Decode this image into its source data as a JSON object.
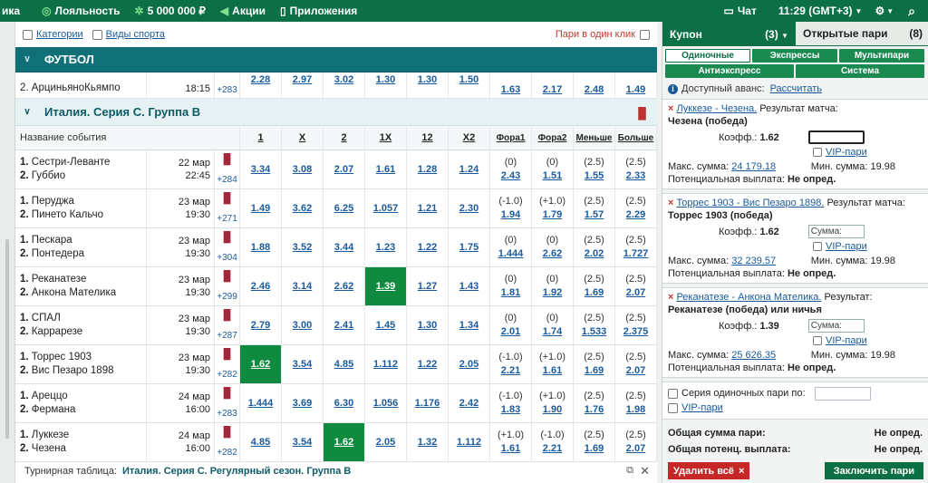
{
  "topbar": {
    "cut_label": "ика",
    "loyalty": "Лояльность",
    "bonus": "5 000 000 ₽",
    "promo": "Акции",
    "apps": "Приложения",
    "chat": "Чат",
    "time": "11:29 (GMT+3)",
    "settings_glyph": "⚙",
    "search_glyph": "⌕"
  },
  "filters": {
    "categories": "Категории",
    "sports": "Виды спорта",
    "one_click": "Пари в один клик"
  },
  "sport": {
    "title": "ФУТБОЛ"
  },
  "partial_event": {
    "team2": "2. АрциньяноКьямпо",
    "date": "24 мар",
    "time": "18:15",
    "more": "+283",
    "odds": [
      "2.28",
      "2.97",
      "3.02",
      "1.30",
      "1.30",
      "1.50"
    ],
    "ext": [
      "1.63",
      "2.17",
      "2.48",
      "1.49"
    ]
  },
  "league": {
    "title": "Италия. Серия С. Группа В"
  },
  "columns": {
    "name": "Название события",
    "c1": "1",
    "cx": "X",
    "c2": "2",
    "c1x": "1X",
    "c12": "12",
    "cx2": "X2",
    "h1": "Фора1",
    "h2": "Фора2",
    "under": "Меньше",
    "over": "Больше"
  },
  "events": [
    {
      "t1": "Сестри-Леванте",
      "t2": "Губбио",
      "date": "22 мар",
      "time": "22:45",
      "more": "+284",
      "odds": [
        "3.34",
        "3.08",
        "2.07",
        "1.61",
        "1.28",
        "1.24"
      ],
      "h1p": "(0)",
      "h1v": "2.43",
      "h2p": "(0)",
      "h2v": "1.51",
      "up": "(2.5)",
      "uv": "1.55",
      "op": "(2.5)",
      "ov": "2.33",
      "sel": -1
    },
    {
      "t1": "Перуджа",
      "t2": "Пинето Кальчо",
      "date": "23 мар",
      "time": "19:30",
      "more": "+271",
      "odds": [
        "1.49",
        "3.62",
        "6.25",
        "1.057",
        "1.21",
        "2.30"
      ],
      "h1p": "(-1.0)",
      "h1v": "1.94",
      "h2p": "(+1.0)",
      "h2v": "1.79",
      "up": "(2.5)",
      "uv": "1.57",
      "op": "(2.5)",
      "ov": "2.29",
      "sel": -1
    },
    {
      "t1": "Пескара",
      "t2": "Понтедера",
      "date": "23 мар",
      "time": "19:30",
      "more": "+304",
      "odds": [
        "1.88",
        "3.52",
        "3.44",
        "1.23",
        "1.22",
        "1.75"
      ],
      "h1p": "(0)",
      "h1v": "1.444",
      "h2p": "(0)",
      "h2v": "2.62",
      "up": "(2.5)",
      "uv": "2.02",
      "op": "(2.5)",
      "ov": "1.727",
      "sel": -1
    },
    {
      "t1": "Реканатезе",
      "t2": "Анкона Мателика",
      "date": "23 мар",
      "time": "19:30",
      "more": "+299",
      "odds": [
        "2.46",
        "3.14",
        "2.62",
        "1.39",
        "1.27",
        "1.43"
      ],
      "h1p": "(0)",
      "h1v": "1.81",
      "h2p": "(0)",
      "h2v": "1.92",
      "up": "(2.5)",
      "uv": "1.69",
      "op": "(2.5)",
      "ov": "2.07",
      "sel": 3
    },
    {
      "t1": "СПАЛ",
      "t2": "Каррарезе",
      "date": "23 мар",
      "time": "19:30",
      "more": "+287",
      "odds": [
        "2.79",
        "3.00",
        "2.41",
        "1.45",
        "1.30",
        "1.34"
      ],
      "h1p": "(0)",
      "h1v": "2.01",
      "h2p": "(0)",
      "h2v": "1.74",
      "up": "(2.5)",
      "uv": "1.533",
      "op": "(2.5)",
      "ov": "2.375",
      "sel": -1
    },
    {
      "t1": "Торрес 1903",
      "t2": "Вис Пезаро 1898",
      "date": "23 мар",
      "time": "19:30",
      "more": "+282",
      "odds": [
        "1.62",
        "3.54",
        "4.85",
        "1.112",
        "1.22",
        "2.05"
      ],
      "h1p": "(-1.0)",
      "h1v": "2.21",
      "h2p": "(+1.0)",
      "h2v": "1.61",
      "up": "(2.5)",
      "uv": "1.69",
      "op": "(2.5)",
      "ov": "2.07",
      "sel": 0
    },
    {
      "t1": "Ареццо",
      "t2": "Фермана",
      "date": "24 мар",
      "time": "16:00",
      "more": "+283",
      "odds": [
        "1.444",
        "3.69",
        "6.30",
        "1.056",
        "1.176",
        "2.42"
      ],
      "h1p": "(-1.0)",
      "h1v": "1.83",
      "h2p": "(+1.0)",
      "h2v": "1.90",
      "up": "(2.5)",
      "uv": "1.76",
      "op": "(2.5)",
      "ov": "1.98",
      "sel": -1
    },
    {
      "t1": "Луккезе",
      "t2": "Чезена",
      "date": "24 мар",
      "time": "16:00",
      "more": "+282",
      "odds": [
        "4.85",
        "3.54",
        "1.62",
        "2.05",
        "1.32",
        "1.112"
      ],
      "h1p": "(+1.0)",
      "h1v": "1.61",
      "h2p": "(-1.0)",
      "h2v": "2.21",
      "up": "(2.5)",
      "uv": "1.69",
      "op": "(2.5)",
      "ov": "2.07",
      "sel": 2
    }
  ],
  "tournament": {
    "label": "Турнирная таблица:",
    "name": "Италия. Серия С. Регулярный сезон. Группа В"
  },
  "coupon": {
    "tab_coupon": "Купон",
    "tab_coupon_count": "(3)",
    "tab_open": "Открытые пари",
    "tab_open_count": "(8)",
    "types": [
      "Одиночные",
      "Экспрессы",
      "Мультипари",
      "Антиэкспресс",
      "Система"
    ],
    "advance_label": "Доступный аванс:",
    "advance_link": "Рассчитать",
    "coef_label": "Коэфф.:",
    "vip": "VIP-пари",
    "sum_placeholder": "Сумма:",
    "max_label": "Макс. сумма:",
    "min_label": "Мин. сумма:",
    "payout_label": "Потенциальная выплата:",
    "bets": [
      {
        "event": "Луккезе - Чезена.",
        "market": "Результат матча:",
        "pick": "Чезена (победа)",
        "coef": "1.62",
        "max": "24 179.18",
        "min": "19.98",
        "payout": "Не опред.",
        "sum_value": ""
      },
      {
        "event": "Торрес 1903 - Вис Пезаро 1898.",
        "market": "Результат матча:",
        "pick": "Торрес 1903 (победа)",
        "coef": "1.62",
        "max": "32 239.57",
        "min": "19.98",
        "payout": "Не опред.",
        "sum_value": "Сумма:"
      },
      {
        "event": "Реканатезе - Анкона Мателика.",
        "market": "Результат:",
        "pick": "Реканатезе (победа) или ничья",
        "coef": "1.39",
        "max": "25 626.35",
        "min": "19.98",
        "payout": "Не опред.",
        "sum_value": "Сумма:"
      }
    ],
    "series_label": "Серия одиночных пари по:",
    "total_sum_label": "Общая сумма пари:",
    "total_sum_value": "Не опред.",
    "total_payout_label": "Общая потенц. выплата:",
    "total_payout_value": "Не опред.",
    "delete_all": "Удалить всё",
    "place_bet": "Заключить пари"
  },
  "colors": {
    "brand": "#0d6f45",
    "sport_header": "#0f7078",
    "selected_odd": "#108a3e",
    "link": "#1a5a9c",
    "danger": "#c62828"
  }
}
